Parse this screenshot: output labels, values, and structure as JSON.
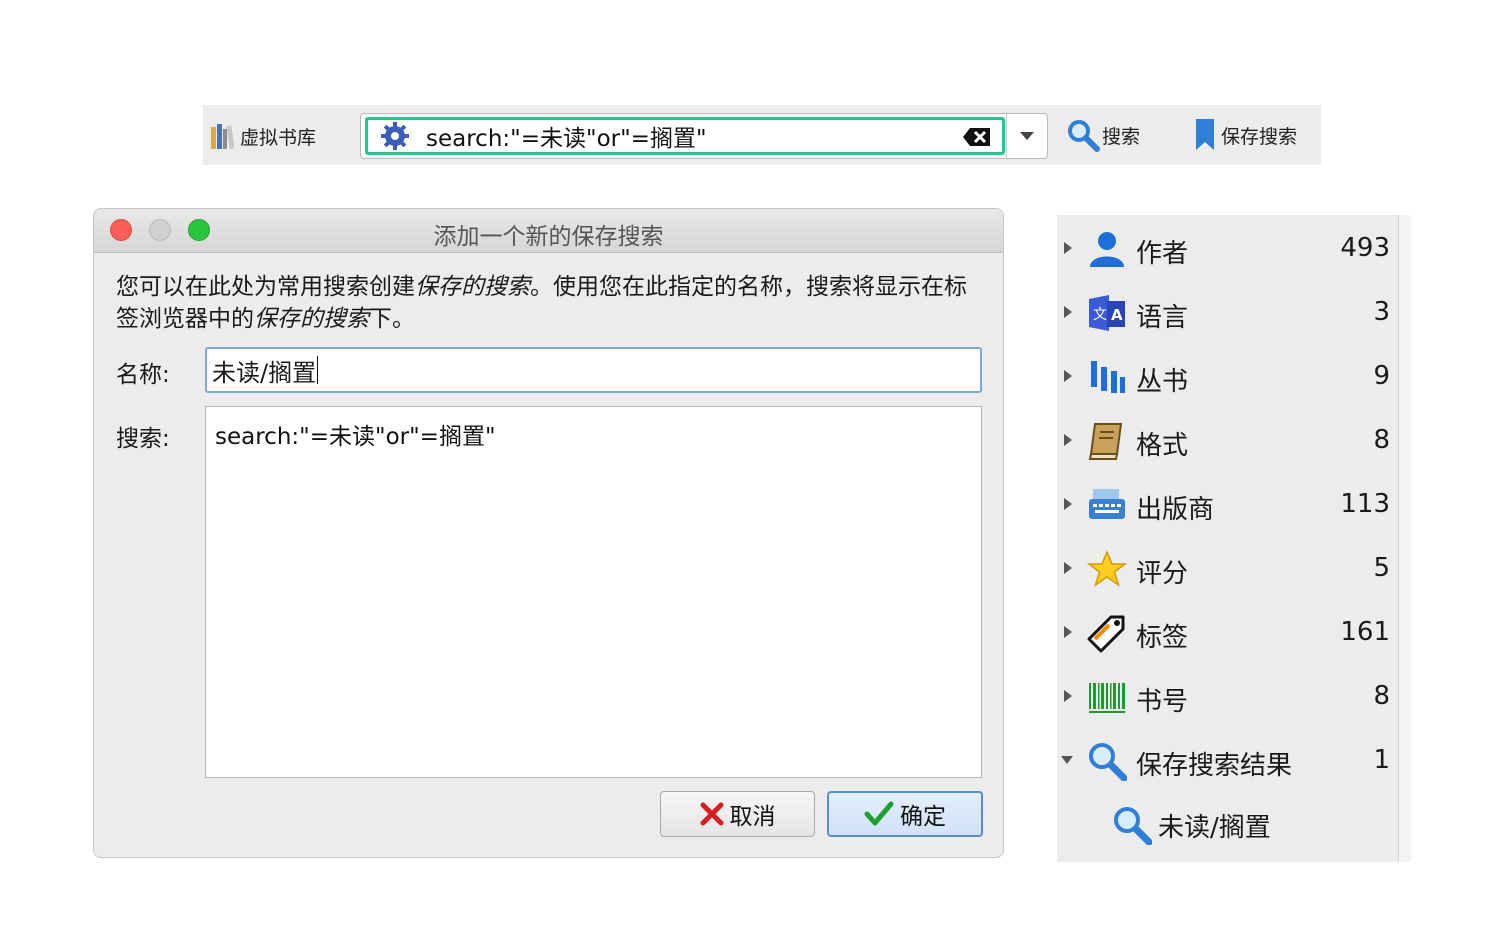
{
  "toolbar": {
    "virtual_library_label": "虚拟书库",
    "search_query": "search:\"=未读\"or\"=搁置\"",
    "search_button_label": "搜索",
    "save_search_label": "保存搜索"
  },
  "dialog": {
    "title": "添加一个新的保存搜索",
    "description_part1": "您可以在此处为常用搜索创建",
    "description_em1": "保存的搜索",
    "description_part2": "。使用您在此指定的名称，搜索将显示在标签浏览器中的",
    "description_em2": "保存的搜索",
    "description_part3": "下。",
    "name_label": "名称:",
    "name_value": "未读/搁置",
    "search_label": "搜索:",
    "search_value": "search:\"=未读\"or\"=搁置\"",
    "cancel_label": "取消",
    "ok_label": "确定"
  },
  "tag_browser": {
    "categories": [
      {
        "label": "作者",
        "count": "493",
        "icon": "person-icon"
      },
      {
        "label": "语言",
        "count": "3",
        "icon": "language-icon"
      },
      {
        "label": "丛书",
        "count": "9",
        "icon": "series-icon"
      },
      {
        "label": "格式",
        "count": "8",
        "icon": "book-format-icon"
      },
      {
        "label": "出版商",
        "count": "113",
        "icon": "publisher-icon"
      },
      {
        "label": "评分",
        "count": "5",
        "icon": "star-icon"
      },
      {
        "label": "标签",
        "count": "161",
        "icon": "tag-icon"
      },
      {
        "label": "书号",
        "count": "8",
        "icon": "barcode-icon"
      },
      {
        "label": "保存搜索结果",
        "count": "1",
        "icon": "magnifier-icon"
      }
    ],
    "saved_search_child": "未读/搁置"
  },
  "colors": {
    "search_focus": "#2bc48a",
    "name_focus": "#7fa7d9",
    "ok_border": "#5b8fd3"
  }
}
